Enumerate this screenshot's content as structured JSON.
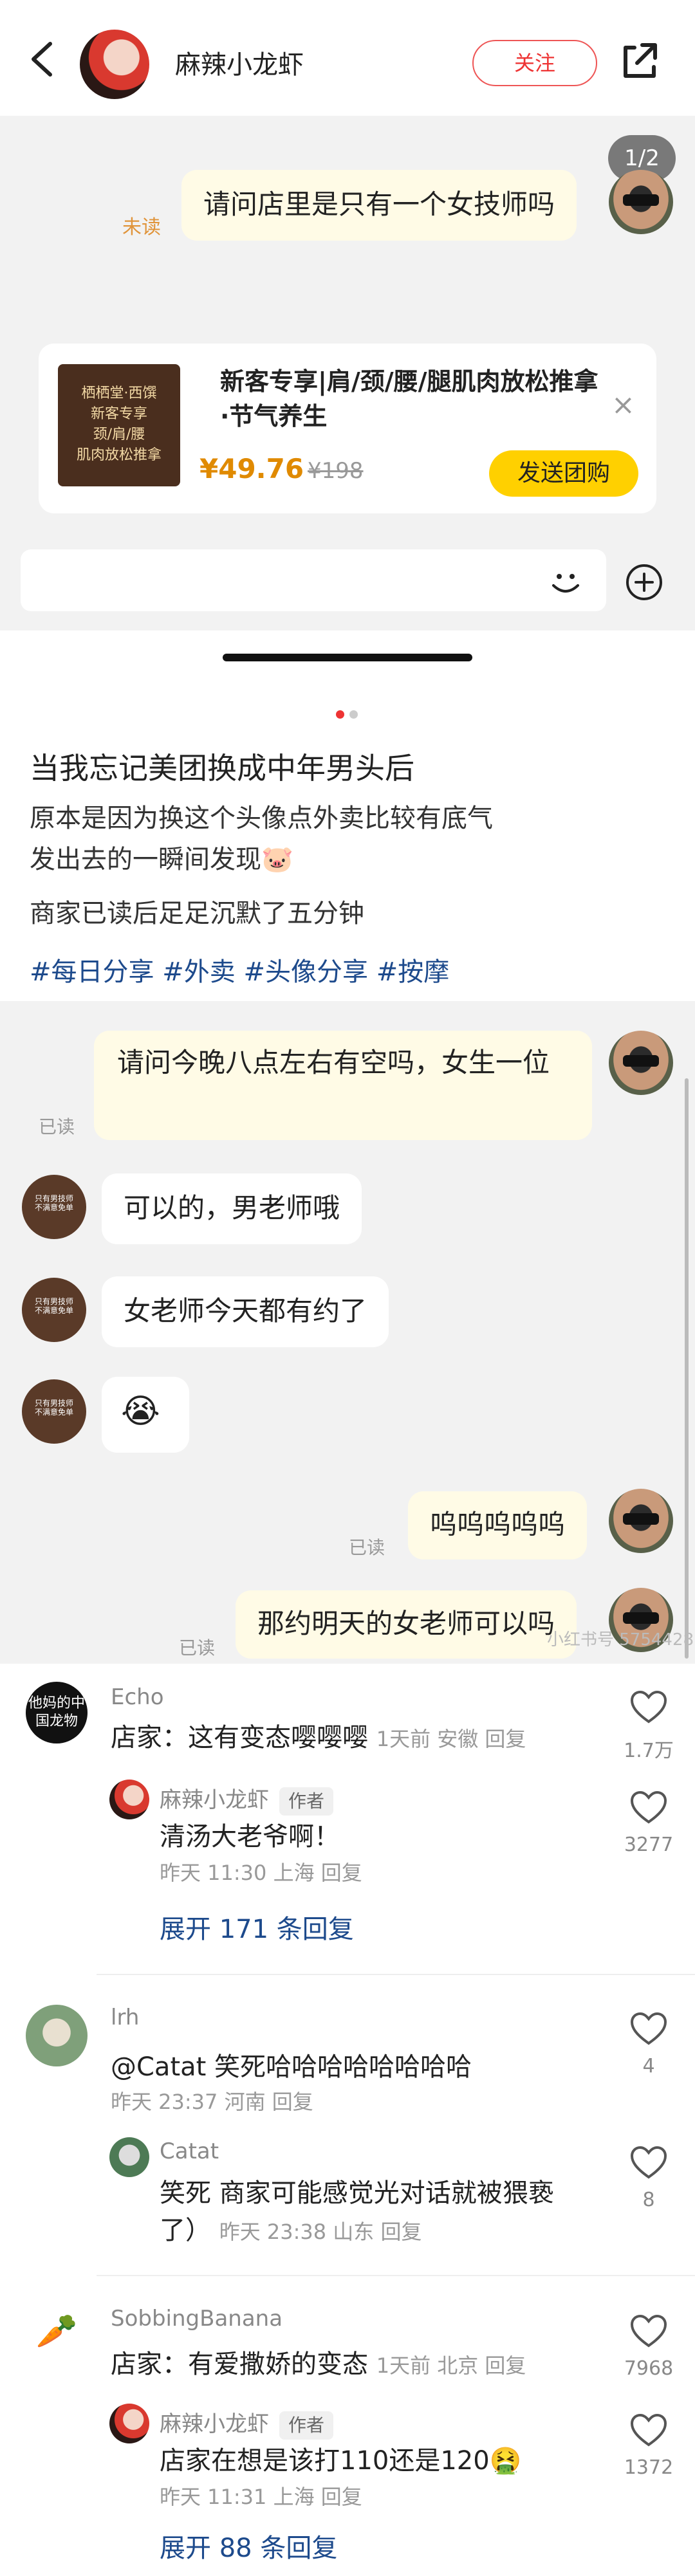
{
  "header": {
    "author": "麻辣小龙虾",
    "follow_label": "关注"
  },
  "chat1": {
    "page_indicator": "1/2",
    "unread": "未读",
    "message": "请问店里是只有一个女技师吗",
    "deal": {
      "title": "新客专享|肩/颈/腰/腿肌肉放松推拿·节气养生",
      "thumb_text": "栖栖堂·西馔\n新客专享\n颈/肩/腰\n肌肉放松推拿",
      "price": "¥49.76",
      "old_price": "¥198",
      "button": "发送团购",
      "close": "×"
    }
  },
  "carousel": {
    "dots": 2,
    "active": 1
  },
  "post": {
    "title": "当我忘记美团换成中年男头后",
    "body_line1": "原本是因为换这个头像点外卖比较有底气",
    "body_line2": "发出去的一瞬间发现🐷",
    "body_line3": "商家已读后足足沉默了五分钟",
    "tags": "#每日分享 #外卖 #头像分享 #按摩"
  },
  "chat2": {
    "m1": "请问今晚八点左右有空吗，女生一位",
    "m1_read": "已读",
    "m2": "可以的，男老师哦",
    "m3": "女老师今天都有约了",
    "m4": "😭",
    "m5": "呜呜呜呜呜",
    "m5_read": "已读",
    "m6": "那约明天的女老师可以吗",
    "m6_read": "已读",
    "watermark": "小红书号 5754428",
    "shop_avatar_text": "只有男技师 不满意免单"
  },
  "comments": [
    {
      "name": "Echo",
      "avatar_text": "他妈的中国龙物",
      "text": "店家：这有变态嘤嘤嘤",
      "meta": "1天前  安徽  回复",
      "likes": "1.7万",
      "reply": {
        "name": "麻辣小龙虾",
        "tag": "作者",
        "text": "清汤大老爷啊！",
        "meta": "昨天 11:30 上海  回复",
        "likes": "3277"
      },
      "expand": "展开 171 条回复"
    },
    {
      "name": "lrh",
      "text": "@Catat 笑死哈哈哈哈哈哈哈哈",
      "meta": "昨天 23:37  河南  回复",
      "likes": "4",
      "reply": {
        "name": "Catat",
        "text_line1": "笑死 商家可能感觉光对话就被猥亵",
        "text_line2": "了）",
        "meta": "昨天 23:38  山东  回复",
        "likes": "8"
      }
    },
    {
      "name": "SobbingBanana",
      "text": "店家：有爱撒娇的变态",
      "meta": "1天前  北京  回复",
      "likes": "7968",
      "reply": {
        "name": "麻辣小龙虾",
        "tag": "作者",
        "text": "店家在想是该打110还是120🤮",
        "meta": "昨天 11:31  上海  回复",
        "likes": "1372"
      },
      "expand": "展开 88 条回复"
    }
  ]
}
